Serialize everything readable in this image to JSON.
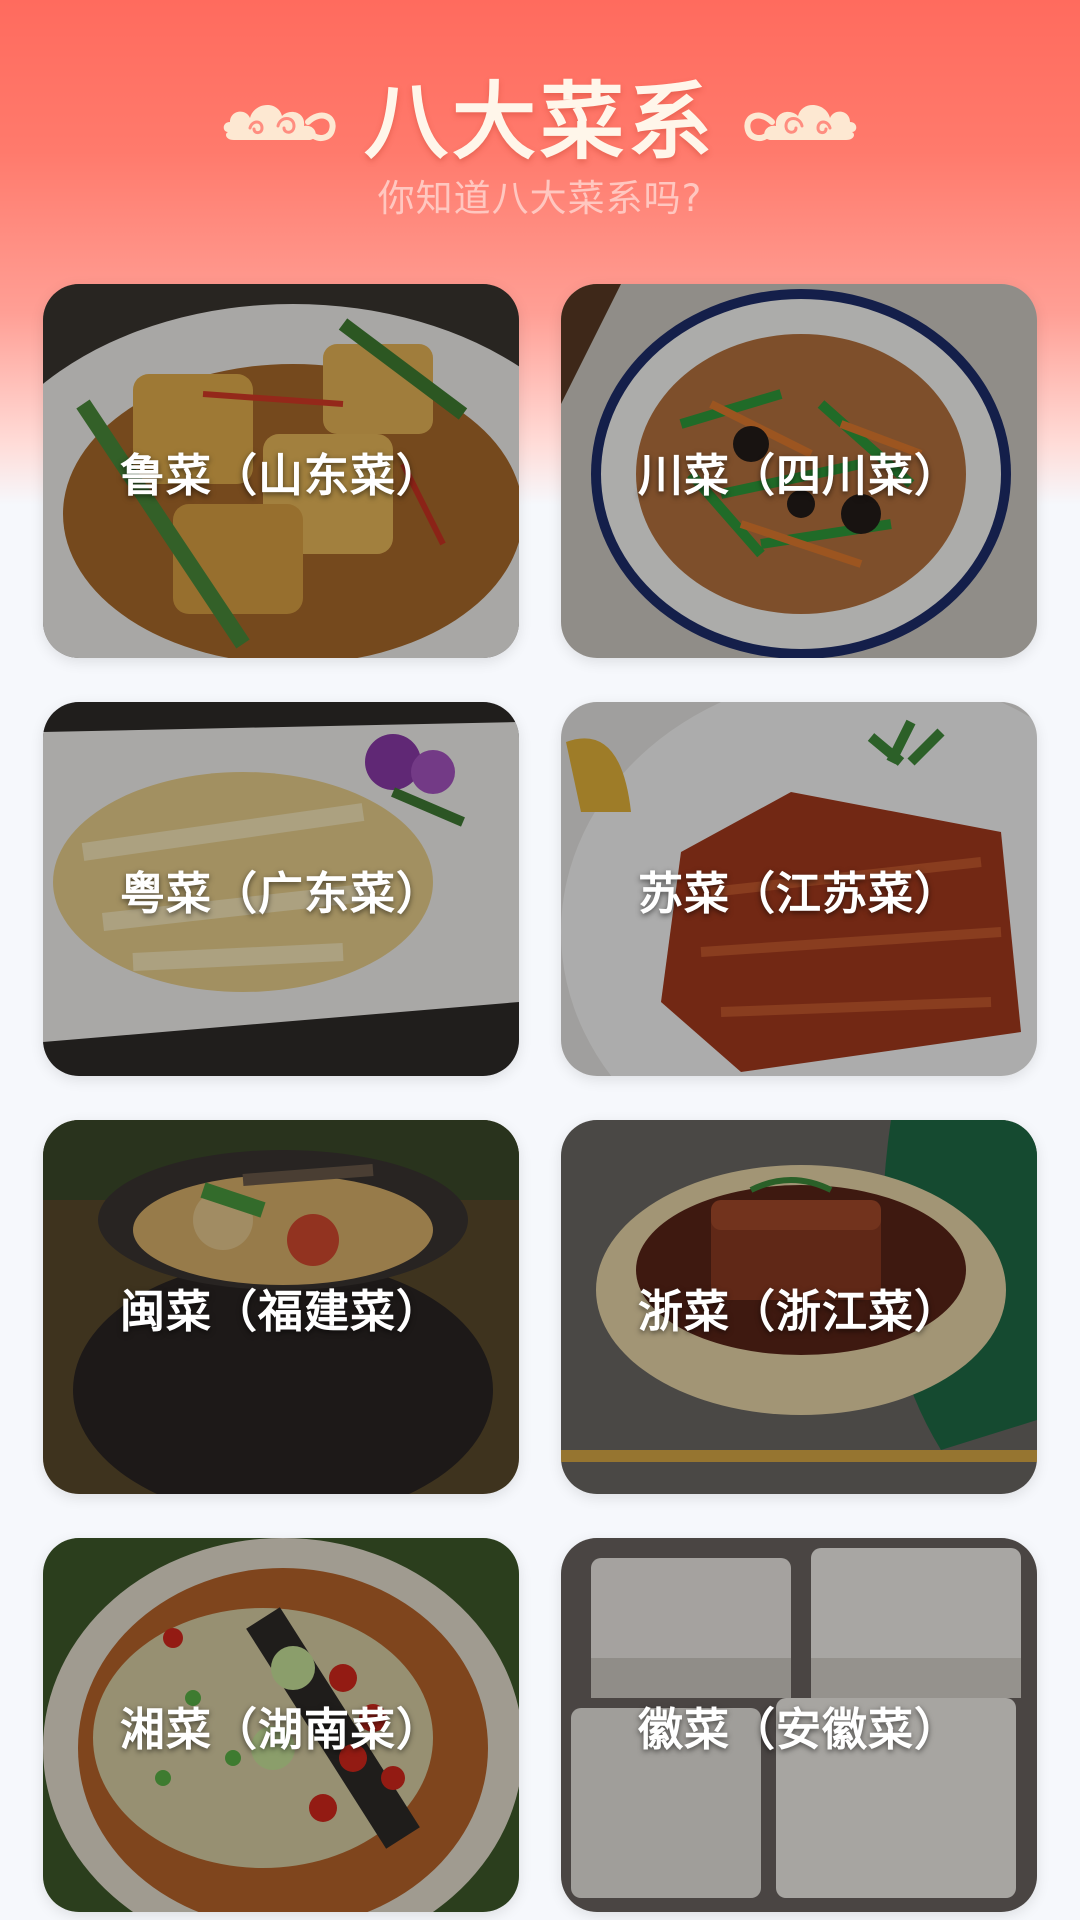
{
  "header": {
    "title": "八大菜系",
    "subtitle": "你知道八大菜系吗?",
    "cloud_color": "#fde8d2"
  },
  "cuisines": [
    {
      "label": "鲁菜（山东菜）",
      "icon": "braised-tofu-photo"
    },
    {
      "label": "川菜（四川菜）",
      "icon": "shredded-pork-photo"
    },
    {
      "label": "粤菜（广东菜）",
      "icon": "white-cut-chicken-photo"
    },
    {
      "label": "苏菜（江苏菜）",
      "icon": "roast-duck-photo"
    },
    {
      "label": "闽菜（福建菜）",
      "icon": "buddha-jumps-wall-photo"
    },
    {
      "label": "浙菜（浙江菜）",
      "icon": "dongpo-pork-photo"
    },
    {
      "label": "湘菜（湖南菜）",
      "icon": "chopped-chili-fish-head-photo"
    },
    {
      "label": "徽菜（安徽菜）",
      "icon": "hairy-tofu-photo"
    }
  ]
}
